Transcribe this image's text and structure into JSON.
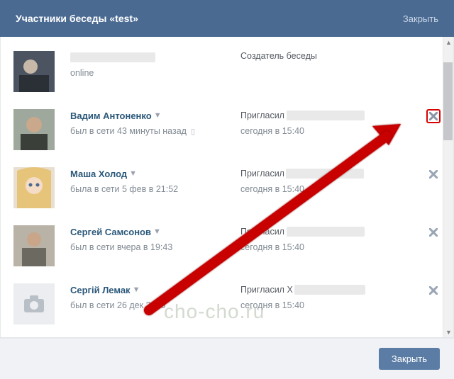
{
  "header": {
    "title": "Участники беседы «test»",
    "close": "Закрыть"
  },
  "members": [
    {
      "name_hidden": true,
      "status": "online",
      "role": "Создатель беседы",
      "removable": false
    },
    {
      "name": "Вадим Антоненко",
      "status": "был в сети 43 минуты назад",
      "mobile": true,
      "invite_prefix": "Пригласил",
      "inviter_hidden": true,
      "invite_date": "сегодня в 15:40",
      "removable": true,
      "highlight_remove": true
    },
    {
      "name": "Маша Холод",
      "status": "была в сети 5 фев в 21:52",
      "invite_prefix": "Пригласил",
      "inviter_hidden": true,
      "invite_date": "сегодня в 15:40",
      "removable": true
    },
    {
      "name": "Сергей Самсонов",
      "status": "был в сети вчера в 19:43",
      "invite_prefix": "Пригласил",
      "inviter_hidden": true,
      "invite_date": "сегодня в 15:40",
      "removable": true
    },
    {
      "name": "Сергій Лемак",
      "status": "был в сети 26 дек 2015",
      "no_avatar": true,
      "invite_prefix": "Пригласил Х",
      "inviter_hidden": true,
      "invite_date": "сегодня в 15:40",
      "removable": true
    }
  ],
  "footer": {
    "close_btn": "Закрыть"
  },
  "watermark": "cho-cho.ru"
}
